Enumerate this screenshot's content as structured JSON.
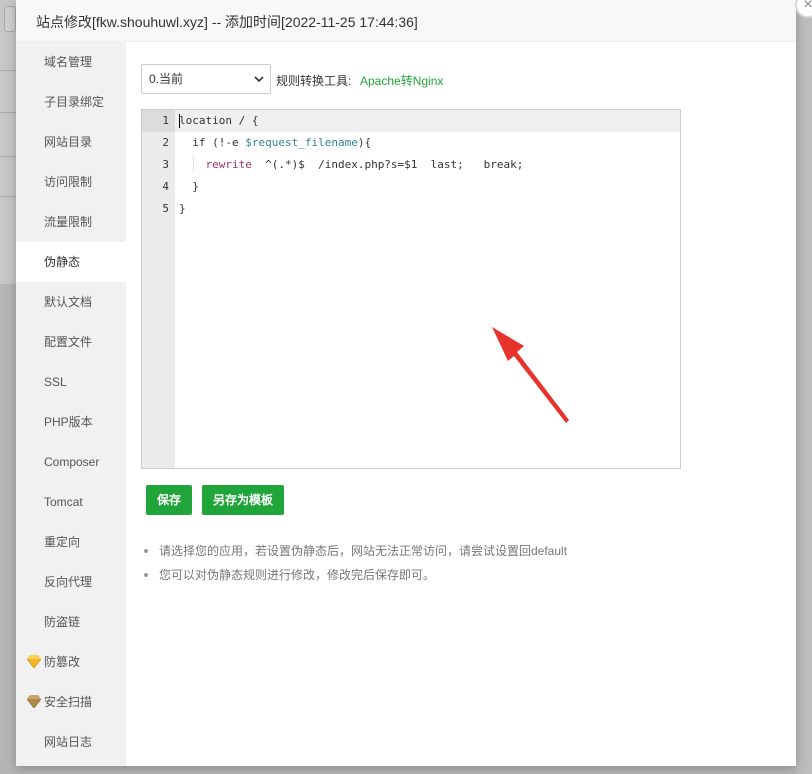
{
  "window": {
    "title": "站点修改[fkw.shouhuwl.xyz] -- 添加时间[2022-11-25 17:44:36]",
    "close_glyph": "×"
  },
  "sidebar": {
    "items": [
      {
        "label": "域名管理",
        "active": false
      },
      {
        "label": "子目录绑定",
        "active": false
      },
      {
        "label": "网站目录",
        "active": false
      },
      {
        "label": "访问限制",
        "active": false
      },
      {
        "label": "流量限制",
        "active": false
      },
      {
        "label": "伪静态",
        "active": true
      },
      {
        "label": "默认文档",
        "active": false
      },
      {
        "label": "配置文件",
        "active": false
      },
      {
        "label": "SSL",
        "active": false
      },
      {
        "label": "PHP版本",
        "active": false
      },
      {
        "label": "Composer",
        "active": false
      },
      {
        "label": "Tomcat",
        "active": false
      },
      {
        "label": "重定向",
        "active": false
      },
      {
        "label": "反向代理",
        "active": false
      },
      {
        "label": "防盗链",
        "active": false
      },
      {
        "label": "防篡改",
        "active": false,
        "icon": "gold-gem-icon"
      },
      {
        "label": "安全扫描",
        "active": false,
        "icon": "bronze-gem-icon"
      },
      {
        "label": "网站日志",
        "active": false
      }
    ]
  },
  "toolbar": {
    "select_value": "0.当前",
    "converter_label": "规则转换工具:",
    "converter_link": "Apache转Nginx"
  },
  "editor": {
    "lines": [
      {
        "num": "1",
        "indent": "",
        "parts": [
          {
            "text": "location / {",
            "cls": "kw"
          }
        ]
      },
      {
        "num": "2",
        "indent": "  ",
        "parts": [
          {
            "text": "if (!-e ",
            "cls": "kw"
          },
          {
            "text": "$request_filename",
            "cls": "var"
          },
          {
            "text": "){",
            "cls": "kw"
          }
        ]
      },
      {
        "num": "3",
        "indent": "    ",
        "parts": [
          {
            "text": "rewrite",
            "cls": "dir"
          },
          {
            "text": "  ^(.*)$  /index.php?s=$1  last;   break;",
            "cls": "kw"
          }
        ]
      },
      {
        "num": "4",
        "indent": "  ",
        "parts": [
          {
            "text": "}",
            "cls": "kw"
          }
        ]
      },
      {
        "num": "5",
        "indent": "",
        "parts": [
          {
            "text": "}",
            "cls": "kw"
          }
        ]
      }
    ]
  },
  "buttons": {
    "save_label": "保存",
    "save_template_label": "另存为模板"
  },
  "tips": [
    "请选择您的应用，若设置伪静态后，网站无法正常访问，请尝试设置回default",
    "您可以对伪静态规则进行修改，修改完后保存即可。"
  ],
  "colors": {
    "accent": "#20a53a",
    "annotation_arrow": "#e8332c",
    "gold_gem": "#f0b623",
    "bronze_gem": "#b08a4a"
  }
}
